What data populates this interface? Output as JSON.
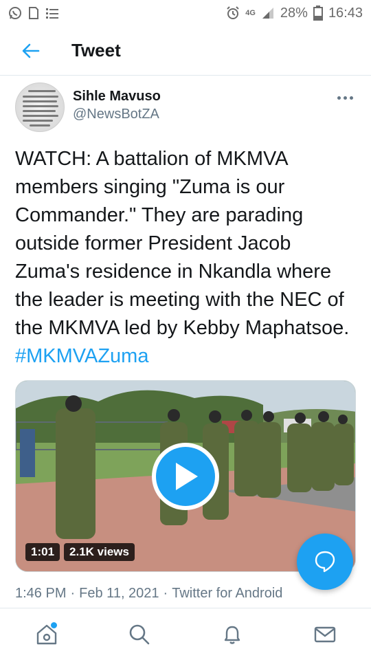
{
  "status_bar": {
    "battery_percent": "28%",
    "time": "16:43",
    "network": "4G",
    "icons": [
      "whatsapp-icon",
      "document-icon",
      "list-icon",
      "alarm-icon",
      "signal-icon",
      "battery-icon"
    ]
  },
  "header": {
    "title": "Tweet"
  },
  "tweet": {
    "author_name": "Sihle Mavuso",
    "author_handle": "@NewsBotZA",
    "text": "WATCH: A battalion of MKMVA members singing \"Zuma is our Commander.\" They are parading outside former President Jacob Zuma's residence in Nkandla where the leader is meeting with the NEC of the MKMVA led by Kebby Maphatsoe. ",
    "hashtag": "#MKMVAZuma",
    "video": {
      "duration": "1:01",
      "views": "2.1K views"
    },
    "time": "1:46 PM",
    "separator": "·",
    "date": "Feb 11, 2021",
    "source": "Twitter for Android"
  },
  "bottom_nav": {
    "items": [
      "home-icon",
      "search-icon",
      "notifications-icon",
      "messages-icon"
    ]
  },
  "colors": {
    "accent": "#1da1f2",
    "text": "#14171a",
    "muted": "#657786"
  }
}
